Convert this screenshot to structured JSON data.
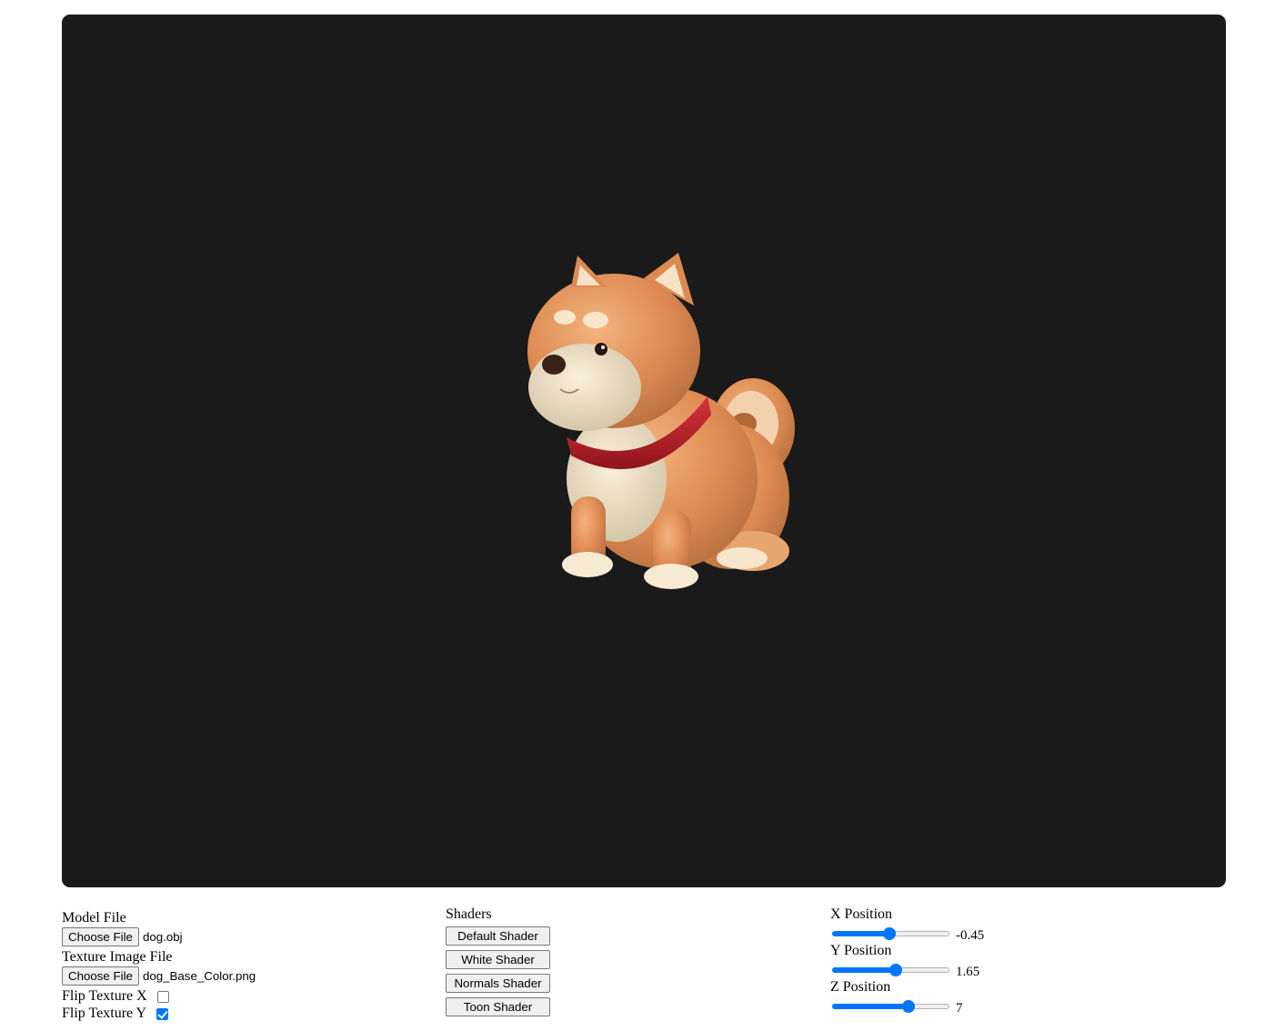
{
  "viewport": {
    "background": "#1a1a1a",
    "model_subject": "shiba-inu-dog-model"
  },
  "model_panel": {
    "model_label": "Model File",
    "model_button": "Choose File",
    "model_filename": "dog.obj",
    "texture_label": "Texture Image File",
    "texture_button": "Choose File",
    "texture_filename": "dog_Base_Color.png",
    "flip_x_label": "Flip Texture X",
    "flip_x_checked": false,
    "flip_y_label": "Flip Texture Y",
    "flip_y_checked": true
  },
  "shader_panel": {
    "title": "Shaders",
    "buttons": [
      "Default Shader",
      "White Shader",
      "Normals Shader",
      "Toon Shader"
    ]
  },
  "position_panel": {
    "sliders": [
      {
        "label": "X Position",
        "value": "-0.45",
        "fraction": 0.49
      },
      {
        "label": "Y Position",
        "value": "1.65",
        "fraction": 0.54
      },
      {
        "label": "Z Position",
        "value": "7",
        "fraction": 0.65
      }
    ]
  },
  "colors": {
    "accent": "#0075ff",
    "button_bg": "#efefef"
  }
}
